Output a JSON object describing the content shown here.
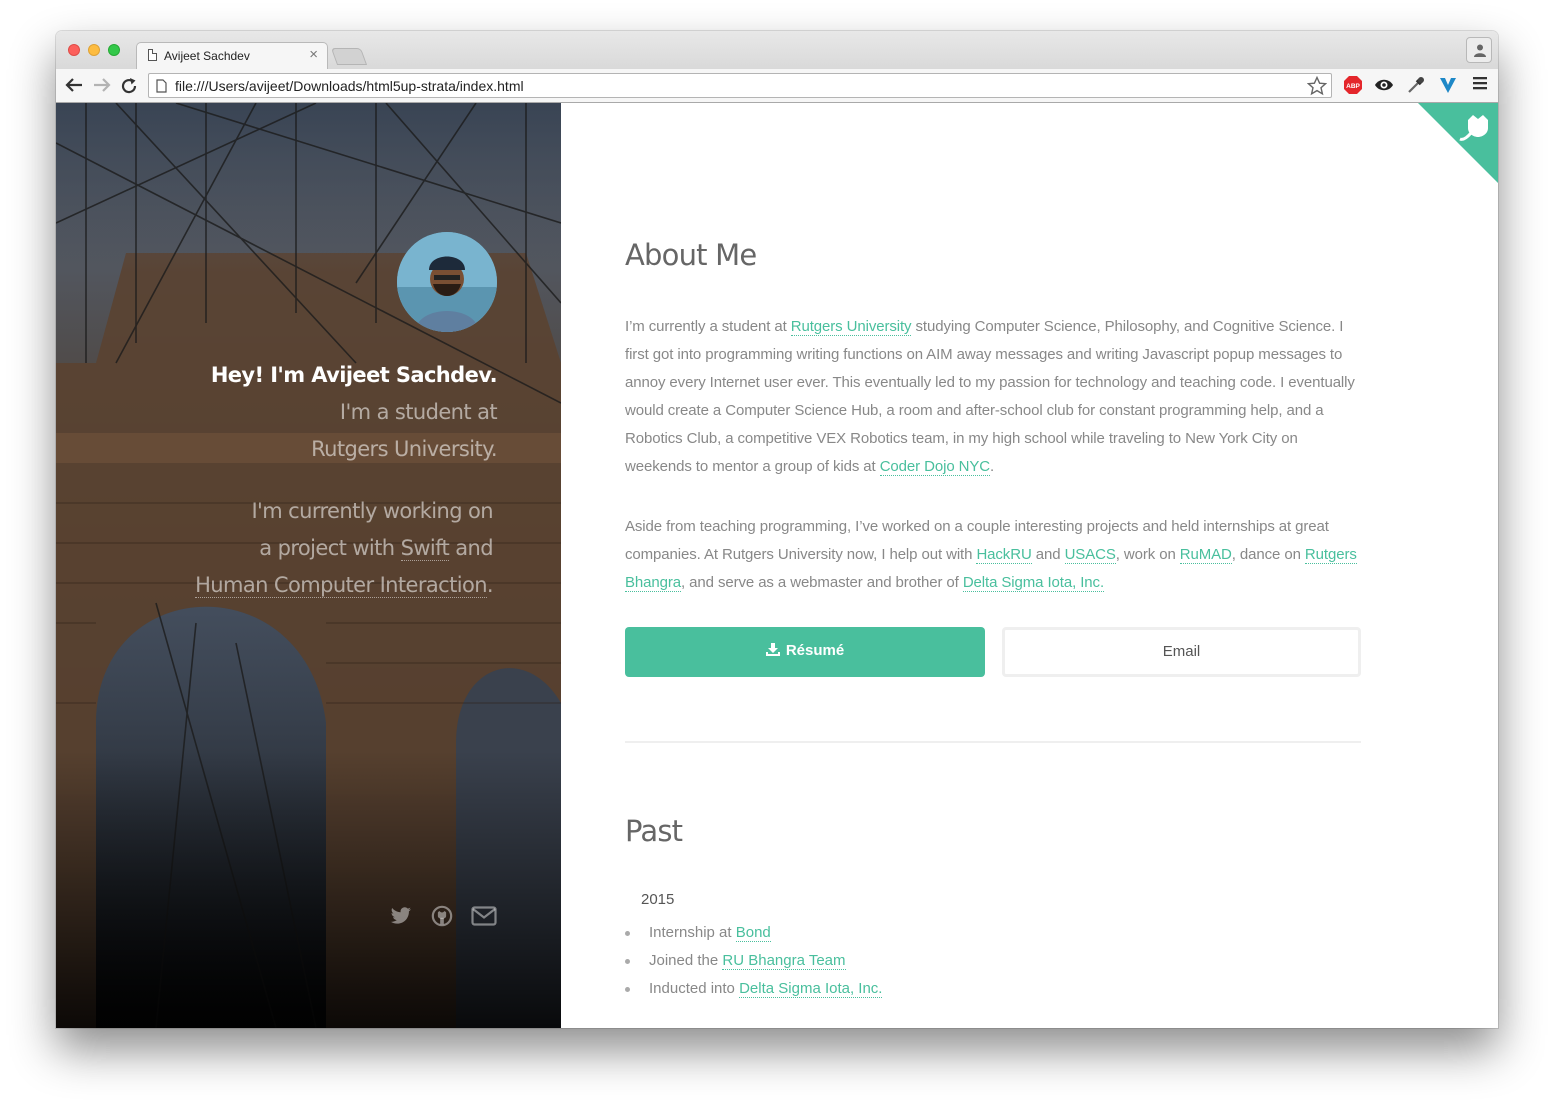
{
  "browser": {
    "tab_title": "Avijeet Sachdev",
    "tab_close": "×",
    "url": "file:///Users/avijeet/Downloads/html5up-strata/index.html",
    "extension_icons": [
      "adblock-plus-icon",
      "eye-icon",
      "eyedropper-icon",
      "vimium-icon",
      "menu-icon"
    ],
    "adblock_label": "ABP"
  },
  "hero": {
    "intro_strong": "Hey! I'm Avijeet Sachdev.",
    "intro_line2": "I'm a student at",
    "intro_line3": "Rutgers University.",
    "work_line1": "I'm currently working on",
    "work_line2a": "a project with ",
    "work_line2_link": "Swift",
    "work_line2b": " and",
    "work_line3_link": "Human Computer Interaction",
    "work_line3b": ".",
    "social_icons": [
      "twitter-icon",
      "github-icon",
      "email-icon"
    ]
  },
  "about": {
    "title": "About Me",
    "p1_a": "I’m currently a student at ",
    "p1_link1": "Rutgers University",
    "p1_b": " studying Computer Science, Philosophy, and Cognitive Science. I first got into programming writing functions on AIM away messages and writing Javascript popup messages to annoy every Internet user ever. This eventually led to my passion for technology and teaching code. I eventually would create a Computer Science Hub, a room and after-school club for constant programming help, and a Robotics Club, a competitive VEX Robotics team, in my high school while traveling to New York City on weekends to mentor a group of kids at ",
    "p1_link2": "Coder Dojo NYC",
    "p1_c": ".",
    "p2_a": "Aside from teaching programming, I’ve worked on a couple interesting projects and held internships at great companies. At Rutgers University now, I help out with ",
    "p2_link1": "HackRU",
    "p2_b": " and ",
    "p2_link2": "USACS",
    "p2_c": ", work on ",
    "p2_link3": "RuMAD",
    "p2_d": ", dance on ",
    "p2_link4": "Rutgers Bhangra",
    "p2_e": ", and serve as a webmaster and brother of ",
    "p2_link5": "Delta Sigma Iota, Inc.",
    "resume_label": "Résumé",
    "email_label": "Email"
  },
  "past": {
    "title": "Past",
    "year": "2015",
    "items": [
      {
        "text": "Internship at ",
        "link": "Bond"
      },
      {
        "text": "Joined the ",
        "link": "RU Bhangra Team"
      },
      {
        "text": "Inducted into ",
        "link": "Delta Sigma Iota, Inc."
      }
    ]
  },
  "colors": {
    "accent": "#49bf9d",
    "body_text": "#888888",
    "heading": "#666666"
  }
}
